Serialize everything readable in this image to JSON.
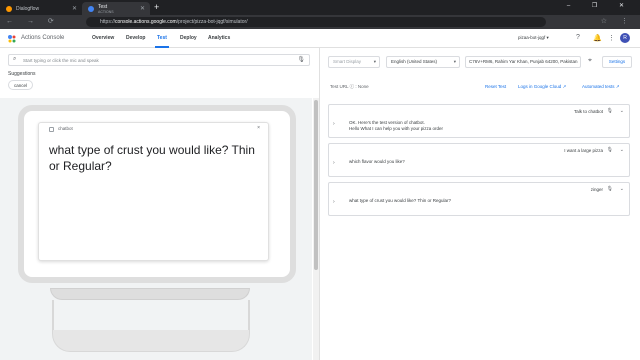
{
  "browser": {
    "tabs": [
      {
        "label": "Dialogflow",
        "sublabel": "",
        "favicon_color": "#ff9800"
      },
      {
        "label": "Test",
        "sublabel": "ACTIONS",
        "favicon_color": "#4285f4"
      }
    ],
    "new_tab": "+",
    "window_controls": "– ❐ ✕",
    "nav_icons": "← → ⟳",
    "url_prefix": "https://",
    "url_domain": "console.actions.google.com",
    "url_path": "/project/pizza-bot-jqgf/simulator/",
    "right_icons": "☆ ⋮"
  },
  "app": {
    "brand": "Actions Console",
    "nav": [
      "Overview",
      "Develop",
      "Test",
      "Deploy",
      "Analytics"
    ],
    "active_nav": "Test",
    "project": "pizaa-bot-jqgf",
    "avatar_letter": "R"
  },
  "left": {
    "input_placeholder": "Start typing or click the mic and speak",
    "suggestions_label": "Suggestions",
    "suggestion_chip": "cancel",
    "card": {
      "name": "chatbot",
      "close": "×",
      "text": "what type of crust you would like? Thin or Regular?"
    }
  },
  "right": {
    "surface": "Smart Display",
    "language": "English (United States)",
    "location": "C76V+RM6, Rahim Yar Khan, Punjab 64200, Pakistan",
    "settings": "Settings",
    "test_url_label": "Test URL",
    "test_url_value": "None",
    "reset": "Reset Test",
    "logs": "Logs in Google Cloud",
    "automated": "Automated tests",
    "turns": [
      {
        "user": "Talk to chatbot",
        "bot": "OK. Here's the test version of chatbot.\nHello What I can help you with your pizza order"
      },
      {
        "user": "I want a large pizza",
        "bot": "which flavor would you like?"
      },
      {
        "user": "zinger",
        "bot": "what type of crust you would like? Thin or Regular?"
      }
    ]
  },
  "colors": {
    "accent": "#1a73e8",
    "chrome_dark": "#202124"
  }
}
